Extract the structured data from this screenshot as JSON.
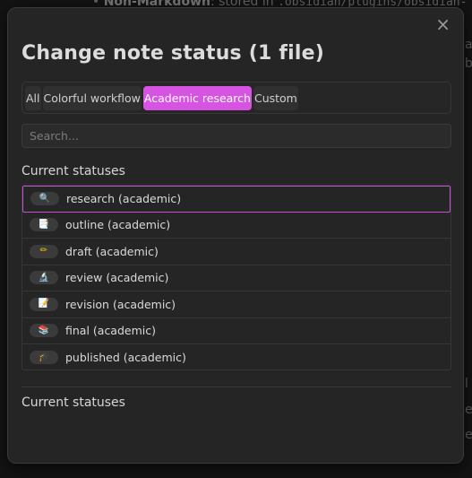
{
  "background": {
    "line_bold": "Non-Markdown",
    "line_text": ": stored in ",
    "line_code": ".obsidian/plugins/obsidian-",
    "edge_chars": [
      "a",
      "b",
      "l",
      "e",
      "e"
    ]
  },
  "modal": {
    "title": "Change note status (1 file)",
    "close_glyph": "×",
    "tabs": [
      {
        "label": "All"
      },
      {
        "label": "Colorful workflow"
      },
      {
        "label": "Academic research"
      },
      {
        "label": "Custom"
      }
    ],
    "active_tab": "Academic research",
    "search": {
      "placeholder": "Search...",
      "value": ""
    },
    "current_statuses_label": "Current statuses",
    "statuses": [
      {
        "icon": "🔍",
        "icon_name": "magnifier-icon",
        "label": "research (academic)",
        "selected": true
      },
      {
        "icon": "📑",
        "icon_name": "bookmark-tabs-icon",
        "label": "outline (academic)"
      },
      {
        "icon": "✏",
        "icon_name": "pencil-icon",
        "label": "draft (academic)"
      },
      {
        "icon": "🔬",
        "icon_name": "microscope-icon",
        "label": "review (academic)"
      },
      {
        "icon": "📝",
        "icon_name": "memo-icon",
        "label": "revision (academic)"
      },
      {
        "icon": "📚",
        "icon_name": "books-icon",
        "label": "final (academic)"
      },
      {
        "icon": "🎓",
        "icon_name": "graduation-cap-icon",
        "label": "published (academic)"
      }
    ],
    "second_section_label": "Current statuses"
  },
  "colors": {
    "accent": "#d754e3",
    "selected_border": "#c550d6",
    "modal_bg": "#252525"
  }
}
